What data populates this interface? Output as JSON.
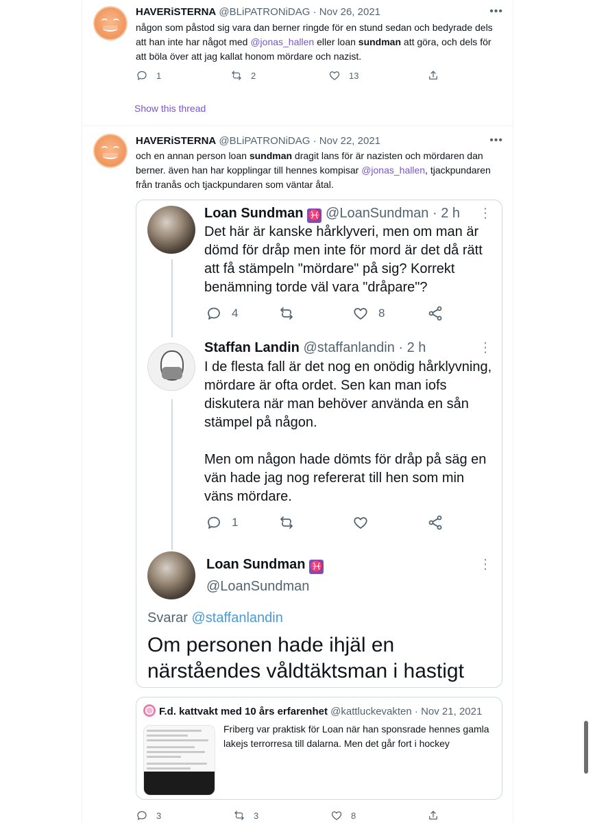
{
  "tweets": [
    {
      "name": "HAVERiSTERNA",
      "handle": "@BLiPATRONiDAG",
      "sep": " · ",
      "date": "Nov 26, 2021",
      "more": "•••",
      "body": {
        "p1": "någon som påstod sig vara dan berner ringde för en stund sedan och bedyrade dels att han inte har något med ",
        "m1": "@jonas_hallen",
        "p2": " eller loan ",
        "b1": "sundman",
        "p3": " att göra, och dels för att böla över att jag kallat honom mördare och nazist."
      },
      "replies": "1",
      "retweets": "2",
      "likes": "13",
      "show_thread": "Show this thread"
    },
    {
      "name": "HAVERiSTERNA",
      "handle": "@BLiPATRONiDAG",
      "sep": " · ",
      "date": "Nov 22, 2021",
      "more": "•••",
      "body": {
        "p1": "och en annan person loan ",
        "b1": "sundman",
        "p2": " dragit lans för är nazisten och mördaren dan berner. även han har kopplingar till hennes kompisar ",
        "m1": "@jonas_hallen",
        "p3": ", tjackpundaren från tranås och tjackpundaren som väntar åtal."
      },
      "replies": "3",
      "retweets": "3",
      "likes": "8"
    }
  ],
  "screenshot": {
    "posts": [
      {
        "name": "Loan Sundman",
        "badge": "♓",
        "handle": "@LoanSundman",
        "time": " · 2 h",
        "more": "⋮",
        "body": "Det här är kanske hårklyveri, men om man är dömd för dråp men inte för mord är det då rätt att få stämpeln \"mördare\" på sig? Korrekt benämning torde väl vara \"dråpare\"?",
        "replies": "4",
        "likes": "8"
      },
      {
        "name": "Staffan Landin",
        "handle": "@staffanlandin",
        "time": " · 2 h",
        "more": "⋮",
        "body1": "I de flesta fall är det nog en onödig hårklyvning, mördare är ofta ordet. Sen kan man iofs diskutera när man behöver använda en sån stämpel på någon.",
        "body2": "Men om någon hade dömts för dråp på säg en vän hade jag nog refererat till hen som min väns mördare.",
        "replies": "1"
      },
      {
        "name": "Loan Sundman",
        "badge": "♓",
        "handle": "@LoanSundman",
        "more": "⋮",
        "replying_prefix": "Svarar ",
        "replying_to": "@staffanlandin",
        "body": "Om personen hade ihjäl en närståendes våldtäktsman i hastigt"
      }
    ]
  },
  "quote": {
    "name": "F.d. kattvakt med 10 års erfarenhet",
    "handle": "@kattluckevakten",
    "sep": " · ",
    "date": "Nov 21, 2021",
    "body": "Friberg var praktisk för Loan när han sponsrade hennes gamla lakejs terrorresa till dalarna. Men det går fort i hockey"
  }
}
